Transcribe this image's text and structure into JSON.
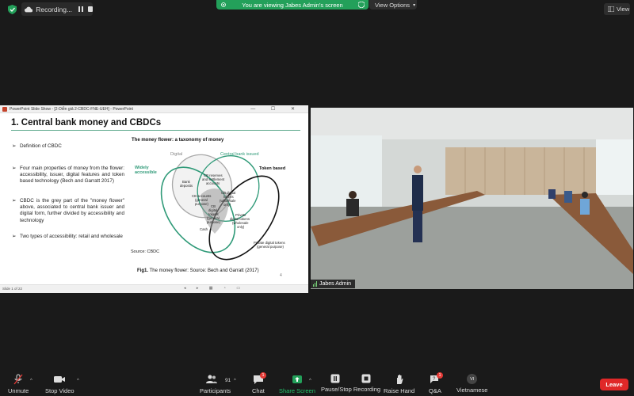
{
  "top_bar": {
    "recording_label": "Recording...",
    "share_banner_text": "You are viewing Jabes Admin's screen",
    "view_options_label": "View Options",
    "view_label": "View"
  },
  "ppt": {
    "window_title": "PowerPoint Slide Show - [2-Diễn giả 2-CBDC-FNE-UEH] - PowerPoint",
    "slide_title": "1. Central bank money and CBDCs",
    "bullets": [
      "Definition of CBDC",
      "Four main properties of money from the flower: accessibility, issuer, digital features and token based technology (Bech and Garratt 2017)",
      "CBDC is the grey part of the \"money flower\" above, associated to central bank issuer and digital form, further divided by accessibility and technology",
      "Two types of accessibility: retail and wholesale"
    ],
    "figure_title": "The money flower: a taxonomy of money",
    "venn_labels": {
      "digital": "Digital",
      "central_bank_issued": "Central bank issued",
      "widely_accessible_1": "Widely",
      "widely_accessible_2": "accessible",
      "token_based": "Token based",
      "bank_deposits_1": "Bank",
      "bank_deposits_2": "deposits",
      "cb_reserves_1": "CB reserves",
      "cb_reserves_2": "and settlement",
      "cb_reserves_3": "accounts",
      "cb_accounts_1": "CB accounts",
      "cb_accounts_2": "(general",
      "cb_accounts_3": "purpose)",
      "cb_digital_wholesale_1": "CB digital",
      "cb_digital_wholesale_2": "tokens",
      "cb_digital_wholesale_3": "(wholesale",
      "cb_digital_wholesale_4": "only)",
      "cb_digital_general_1": "CB",
      "cb_digital_general_2": "digital",
      "cb_digital_general_3": "tokens",
      "cb_digital_general_4": "(general",
      "cb_digital_general_5": "purpose)",
      "cash": "Cash",
      "private_wholesale_1": "Private",
      "private_wholesale_2": "digital tokens",
      "private_wholesale_3": "(wholesale",
      "private_wholesale_4": "only)",
      "private_general_1": "Private digital tokens",
      "private_general_2": "(general purpose)"
    },
    "source": "Source: CBDC",
    "caption_bold": "Fig1.",
    "caption_rest": " The money flower: Source: Bech and Garratt (2017)",
    "status": "Slide 1 of 22",
    "page_marker": "4"
  },
  "video": {
    "participant_name": "Jabes Admin"
  },
  "toolbar": {
    "unmute": "Unmute",
    "stop_video": "Stop Video",
    "participants": "Participants",
    "participants_count": "91",
    "chat": "Chat",
    "chat_badge": "1",
    "share_screen": "Share Screen",
    "pause_recording": "Pause/Stop Recording",
    "raise_hand": "Raise Hand",
    "qa": "Q&A",
    "qa_badge": "1",
    "language": "Vietnamese",
    "language_code": "VI",
    "leave": "Leave"
  },
  "colors": {
    "share_green": "#23a05a",
    "leave_red": "#e02828",
    "venn_green": "#2f9a78"
  }
}
